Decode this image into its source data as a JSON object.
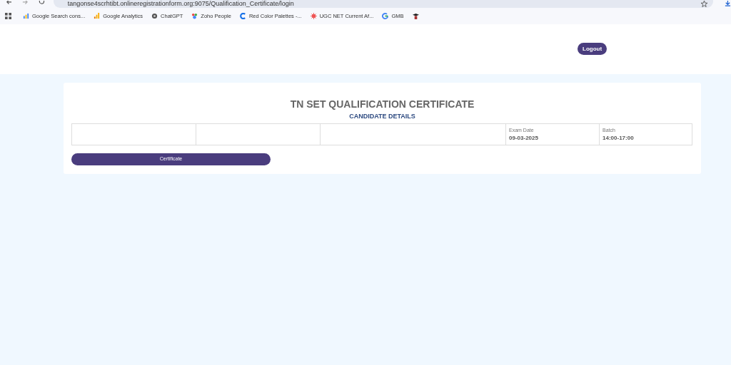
{
  "browser": {
    "url": "tangonse4scrhtibt.onlineregistrationform.org:9075/Qualification_Certificate/login",
    "bookmarks": [
      {
        "label": "Google Search cons..."
      },
      {
        "label": "Google Analytics"
      },
      {
        "label": "ChatGPT"
      },
      {
        "label": "Zoho People"
      },
      {
        "label": "Red Color Palettes -..."
      },
      {
        "label": "UGC NET Current Af..."
      },
      {
        "label": "GMB"
      }
    ]
  },
  "header": {
    "logout": "Logout"
  },
  "card": {
    "title": "TN SET QUALIFICATION CERTIFICATE",
    "subtitle": "CANDIDATE DETAILS",
    "cells": [
      {},
      {},
      {},
      {
        "label": "Exam Date",
        "value": "09-03-2025"
      },
      {
        "label": "Batch",
        "value": "14:00-17:00"
      }
    ],
    "button": "Certificate"
  }
}
